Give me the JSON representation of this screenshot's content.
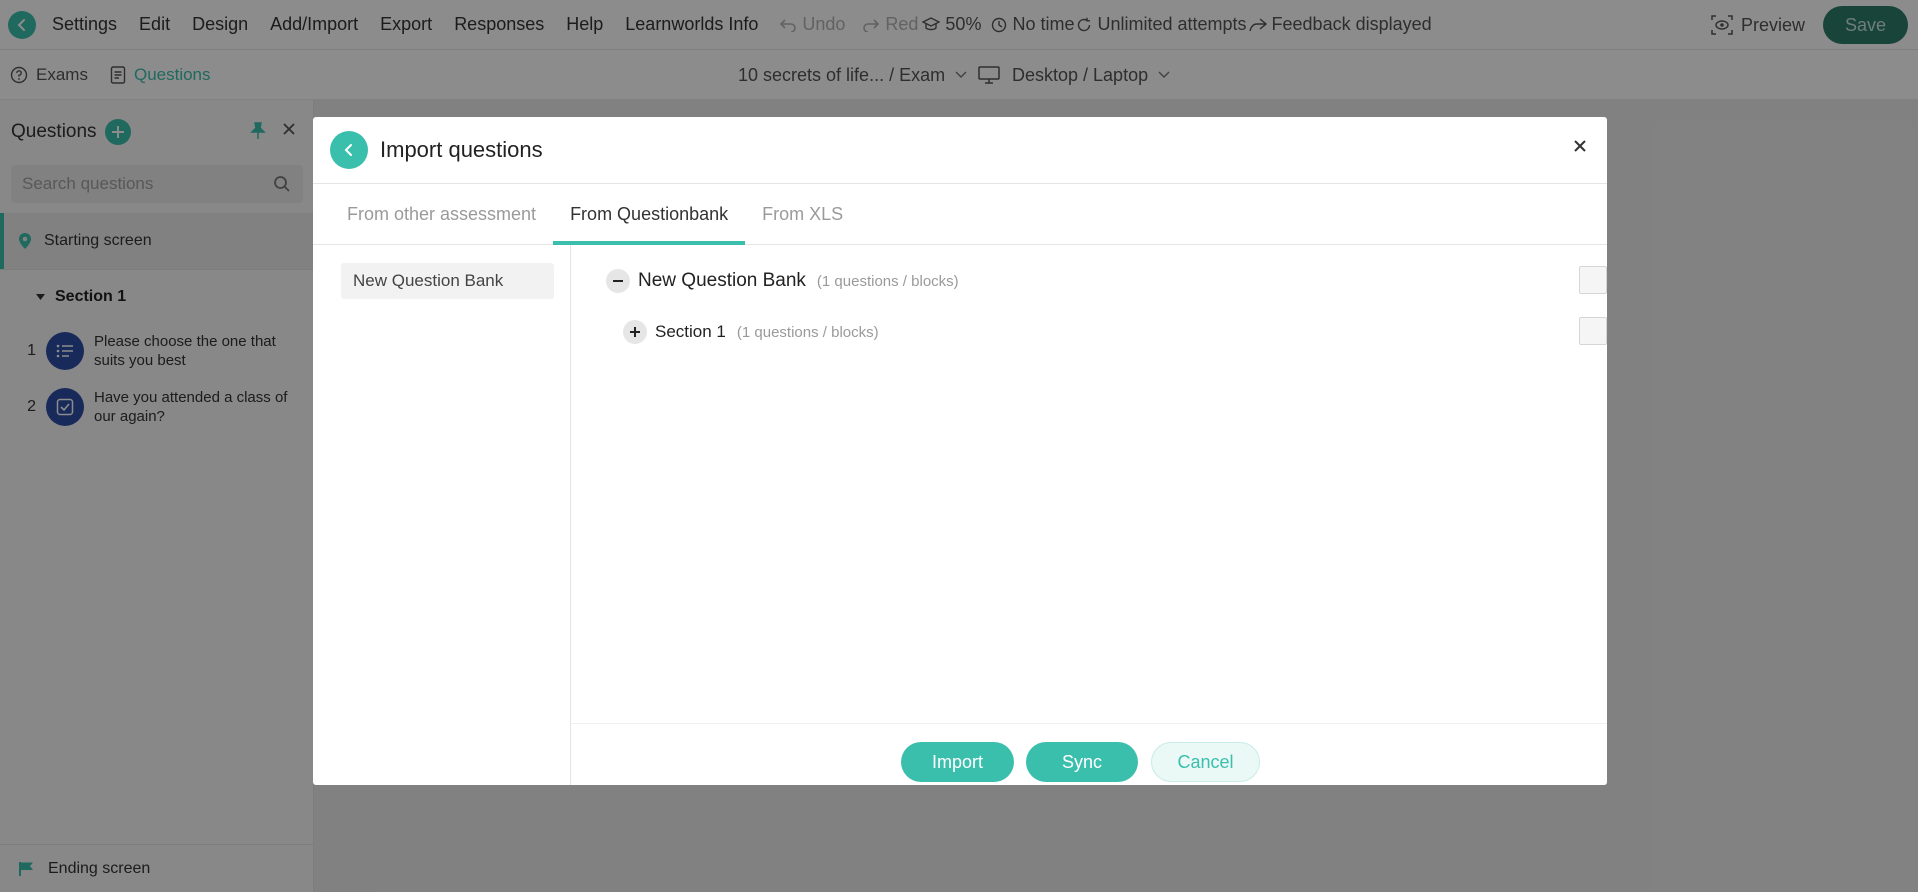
{
  "topbar": {
    "menu": [
      "Settings",
      "Edit",
      "Design",
      "Add/Import",
      "Export",
      "Responses",
      "Help",
      "Learnworlds Info"
    ],
    "undo_label": "Undo",
    "redo_label": "Red",
    "pass_score": "50%",
    "time_label": "No time",
    "attempts_label": "Unlimited attempts",
    "feedback_label": "Feedback displayed",
    "preview_label": "Preview",
    "save_label": "Save"
  },
  "subbar": {
    "tabs": [
      "Exams",
      "Questions"
    ],
    "active_tab": "Questions",
    "course_select": "10 secrets of life... / Exam",
    "device_select": "Desktop / Laptop"
  },
  "sidebar": {
    "title": "Questions",
    "search_placeholder": "Search questions",
    "starting_screen": "Starting screen",
    "section_label": "Section 1",
    "questions": [
      {
        "number": "1",
        "text": "Please choose the one that suits you best",
        "icon": "list-icon"
      },
      {
        "number": "2",
        "text": "Have you attended a class of our again?",
        "icon": "checkbox-icon"
      }
    ],
    "ending_screen": "Ending screen"
  },
  "modal": {
    "title": "Import questions",
    "tabs": [
      "From other assessment",
      "From Questionbank",
      "From XLS"
    ],
    "active_tab": "From Questionbank",
    "bank_list": [
      "New Question Bank"
    ],
    "tree": {
      "bank_name": "New Question Bank",
      "bank_count": "(1 questions / blocks)",
      "section_name": "Section 1",
      "section_count": "(1 questions / blocks)"
    },
    "footer": {
      "import_label": "Import",
      "sync_label": "Sync",
      "cancel_label": "Cancel"
    }
  },
  "colors": {
    "accent": "#3bbfad",
    "save": "#2e7d6b",
    "question_avatar": "#2b4ea2"
  }
}
